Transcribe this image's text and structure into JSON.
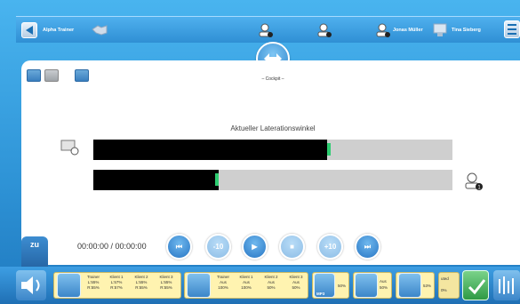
{
  "header": {
    "trainer_label": "Alpha Trainer",
    "user1": "Jonas Müller",
    "user2": "Tina Sieberg"
  },
  "cockpit": {
    "label": "– Cockpit –"
  },
  "lateration": {
    "title": "Aktueller Laterationswinkel",
    "bar1_fill_pct": 65,
    "bar2_fill_pct": 35,
    "client_badge": "1"
  },
  "transport": {
    "time": "00:00:00 / 00:00:00",
    "back10": "-10",
    "fwd10": "+10"
  },
  "zu": {
    "label": "zu"
  },
  "volume_block": {
    "headers": [
      "Trainer",
      "Klient 1",
      "Klient 2",
      "Klient 3"
    ],
    "row1": [
      "L:55%",
      "L:57%",
      "L:55%",
      "L:55%"
    ],
    "row2": [
      "R:55%",
      "R:57%",
      "R:55%",
      "R:55%"
    ]
  },
  "mic_block": {
    "headers": [
      "Trainer",
      "Klient 1",
      "Klient 2",
      "Klient 3"
    ],
    "row1": [
      "Aus",
      "Aus",
      "Aus",
      "Aus"
    ],
    "row2": [
      "100%",
      "100%",
      "50%",
      "50%"
    ]
  },
  "mp3_block": {
    "badge": "MP3",
    "pct": "50%"
  },
  "aus_block": {
    "label": "Aus",
    "pct": "50%"
  },
  "input_block": {
    "pct": "53%"
  },
  "misc_block": {
    "line1": "uted",
    "line2": "0%"
  },
  "colors": {
    "accent": "#2876c4",
    "progress_fill": "#000000",
    "marker": "#2ecc71"
  }
}
